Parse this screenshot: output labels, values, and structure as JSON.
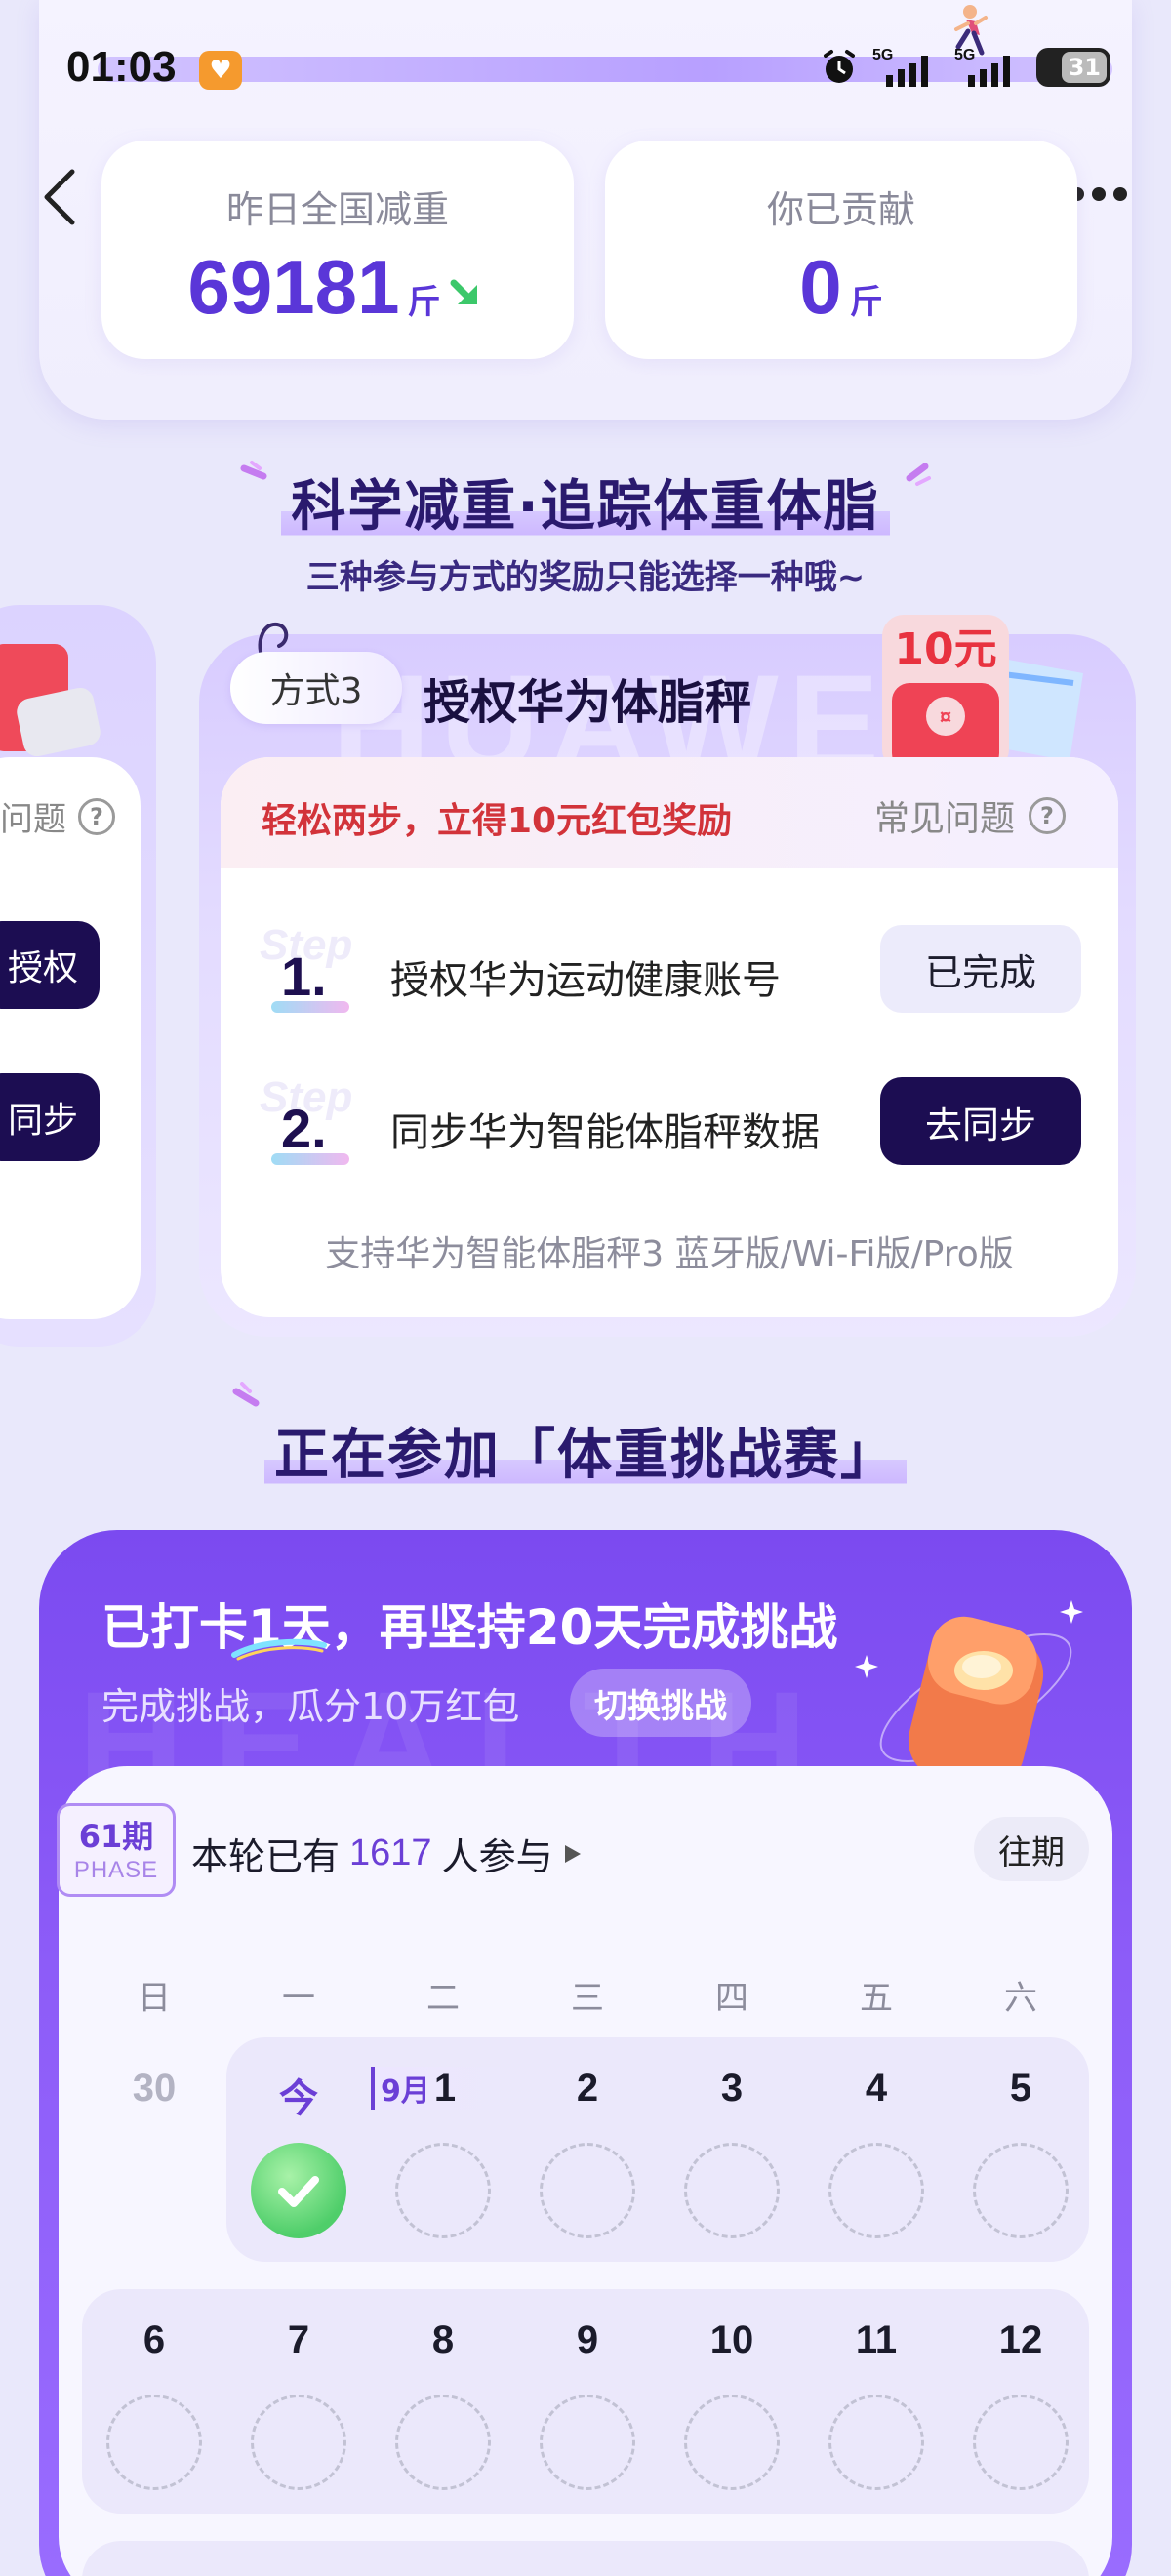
{
  "status_bar": {
    "time": "01:03",
    "network_1": "5G",
    "network_2": "5G",
    "battery": "31"
  },
  "stats": {
    "national_label": "昨日全国减重",
    "national_value": "69181",
    "national_unit": "斤",
    "contribution_label": "你已贡献",
    "contribution_value": "0",
    "contribution_unit": "斤"
  },
  "section1": {
    "title": "科学减重·追踪体重体脂",
    "subtitle": "三种参与方式的奖励只能选择一种哦~"
  },
  "side_card": {
    "faq_partial": "问题",
    "btn1_partial": "授权",
    "btn2_partial": "同步"
  },
  "method": {
    "tag": "方式3",
    "title": "授权华为体脂秤",
    "bonus": "10元",
    "reward": "轻松两步，立得10元红包奖励",
    "faq": "常见问题",
    "step_word": "Step",
    "steps": [
      {
        "number": "1.",
        "text": "授权华为运动健康账号",
        "button": "已完成"
      },
      {
        "number": "2.",
        "text": "同步华为智能体脂秤数据",
        "button": "去同步"
      }
    ],
    "support_note": "支持华为智能体脂秤3 蓝牙版/Wi-Fi版/Pro版"
  },
  "section2": {
    "title": "正在参加「体重挑战赛」"
  },
  "challenge": {
    "headline": "已打卡1天，再坚持20天完成挑战",
    "subline": "完成挑战，瓜分10万红包",
    "switch_button": "切换挑战",
    "phase_number": "61期",
    "phase_word": "PHASE",
    "participants_prefix": "本轮已有",
    "participants_count": "1617",
    "participants_suffix": "人参与",
    "past_button": "往期",
    "weekdays": [
      "日",
      "一",
      "二",
      "三",
      "四",
      "五",
      "六"
    ],
    "week1": [
      "30",
      "今",
      "1",
      "2",
      "3",
      "4",
      "5"
    ],
    "month_label": "9月",
    "week2": [
      "6",
      "7",
      "8",
      "9",
      "10",
      "11",
      "12"
    ]
  },
  "colors": {
    "accent": "#6b3fd6",
    "challenge_bg": "#8d5cf8",
    "button_dark": "#1c0d52",
    "reward_red": "#d2333a",
    "check_green": "#4fce6a"
  }
}
